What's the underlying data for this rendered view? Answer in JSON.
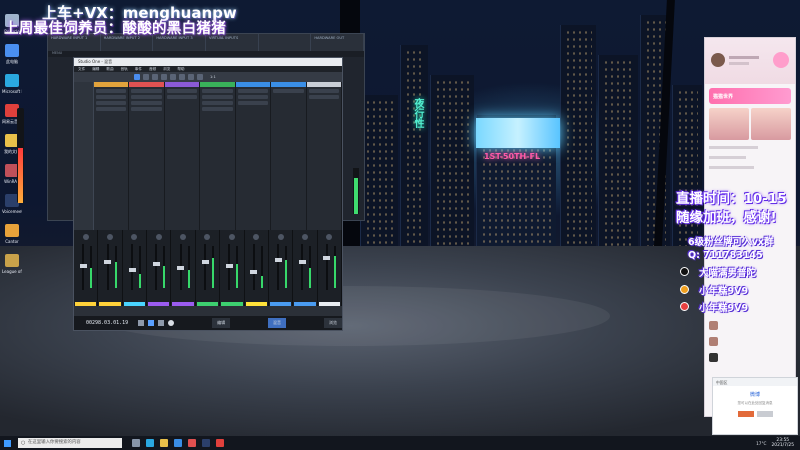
{
  "overlay": {
    "line1": "上车+VX：menghuanpw",
    "line2": "上周最佳饲养员：酸酸的黑白猪猪"
  },
  "city": {
    "sign1": "1ST-50TH-FL",
    "sign2": "夜行性"
  },
  "desktop_icons": [
    {
      "label": "Recycle",
      "color": "#9fb4cc"
    },
    {
      "label": "此电脑",
      "color": "#4a8ff0"
    },
    {
      "label": "Microsoft Edge",
      "color": "#2aa8e0"
    },
    {
      "label": "网易云音乐",
      "color": "#e0403c"
    },
    {
      "label": "我的文档",
      "color": "#e8c04a"
    },
    {
      "label": "WinRAR",
      "color": "#c0505a"
    },
    {
      "label": "Voicemeeter Banana",
      "color": "#2b3f6a"
    },
    {
      "label": "Cantor",
      "color": "#e8a23a"
    },
    {
      "label": "League of Legends",
      "color": "#c9a24a"
    }
  ],
  "interface": {
    "channels": [
      "HARDWARE INPUT 1",
      "HARDWARE INPUT 2",
      "HARDWARE INPUT 3",
      "VIRTUAL INPUTS",
      "",
      "HARDWARE OUT"
    ],
    "sub": "MENU"
  },
  "studio_one": {
    "title": "Studio One - 混音",
    "menu": [
      "文件",
      "编辑",
      "歌曲",
      "音轨",
      "事件",
      "音频",
      "浏览",
      "帮助"
    ],
    "zoom": "1:1",
    "time": "00298.03.01.19",
    "tabs": [
      "编辑",
      "混音",
      "浏览"
    ]
  },
  "live_panel": {
    "banner": "猫猫世界"
  },
  "right_text": {
    "line1": "直播时间：10-15",
    "line2": "随缘加班，感谢!",
    "s1": "6级粉丝牌可入vx群",
    "s2": "Q:  711783145",
    "s3": "大喵满男普陀",
    "s4": "小年糕9V9",
    "s5": "小年糕9V9"
  },
  "notification": {
    "title": "中国区",
    "body": "微博",
    "sub": "您可以在此处回复消息"
  },
  "taskbar": {
    "search_placeholder": "在这里输入你要搜索的内容",
    "temp": "17°C",
    "time": "23:55",
    "date": "2021/7/25"
  }
}
